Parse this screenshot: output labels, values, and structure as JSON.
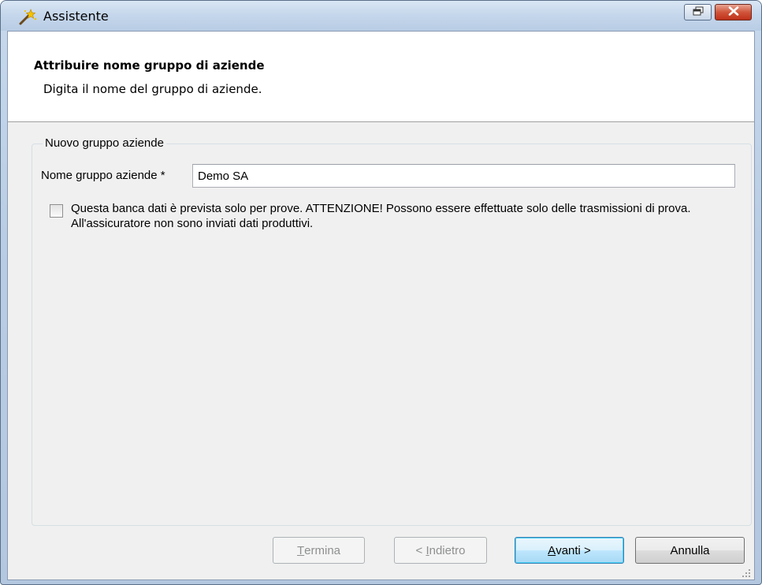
{
  "window": {
    "title": "Assistente",
    "icon": "wand-icon",
    "buttons": {
      "restore_icon": "restore-icon",
      "close_icon": "close-icon"
    }
  },
  "header": {
    "title": "Attribuire nome gruppo di aziende",
    "subtitle": "Digita il nome del gruppo di aziende."
  },
  "group": {
    "legend": "Nuovo gruppo aziende",
    "name_label": "Nome gruppo aziende *",
    "name_value": "Demo SA",
    "test_checkbox_checked": false,
    "test_checkbox_label": "Questa banca dati è prevista solo per prove. ATTENZIONE! Possono essere effettuate solo delle trasmissioni di prova. All'assicuratore non sono inviati dati produttivi."
  },
  "footer": {
    "finish": {
      "prefix": "",
      "mnemonic": "T",
      "rest": "ermina"
    },
    "back": {
      "prefix": "< ",
      "mnemonic": "I",
      "rest": "ndietro"
    },
    "next": {
      "prefix": "",
      "mnemonic": "A",
      "rest": "vanti >"
    },
    "cancel": {
      "label": "Annulla"
    }
  },
  "colors": {
    "title_bar": "#c4d6eb",
    "close_button": "#c0301a",
    "default_button_border": "#3c7fb1",
    "panel_background": "#f0f0f0"
  }
}
